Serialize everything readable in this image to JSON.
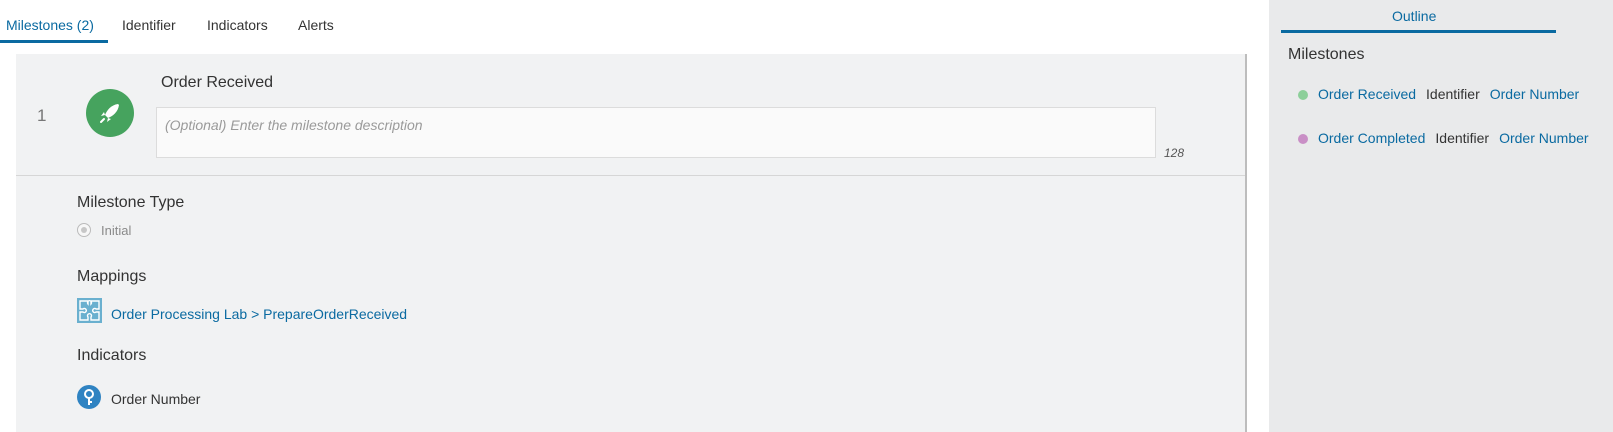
{
  "tabs": [
    {
      "label": "Milestones (2)",
      "active": true
    },
    {
      "label": "Identifier"
    },
    {
      "label": "Indicators"
    },
    {
      "label": "Alerts"
    }
  ],
  "milestone": {
    "number": "1",
    "title": "Order Received",
    "icon": "rocket-icon",
    "description_placeholder": "(Optional) Enter the milestone description",
    "description_value": "",
    "char_count": "128",
    "type_label": "Milestone Type",
    "type_option": "Initial",
    "mappings_label": "Mappings",
    "mapping_link": "Order Processing Lab > PrepareOrderReceived",
    "indicators_label": "Indicators",
    "indicator_item": "Order Number"
  },
  "outline": {
    "tab_label": "Outline",
    "heading": "Milestones",
    "items": [
      {
        "dot_color": "#8ccf99",
        "milestone": "Order Received",
        "identifier_label": "Identifier",
        "identifier": "Order Number"
      },
      {
        "dot_color": "#c98fc6",
        "milestone": "Order Completed",
        "identifier_label": "Identifier",
        "identifier": "Order Number"
      }
    ]
  },
  "colors": {
    "accent": "#0a6aa1",
    "milestone_icon_bg": "#46a35e",
    "mapping_icon": "#6ab0cf",
    "indicator_icon": "#2f83c2"
  }
}
